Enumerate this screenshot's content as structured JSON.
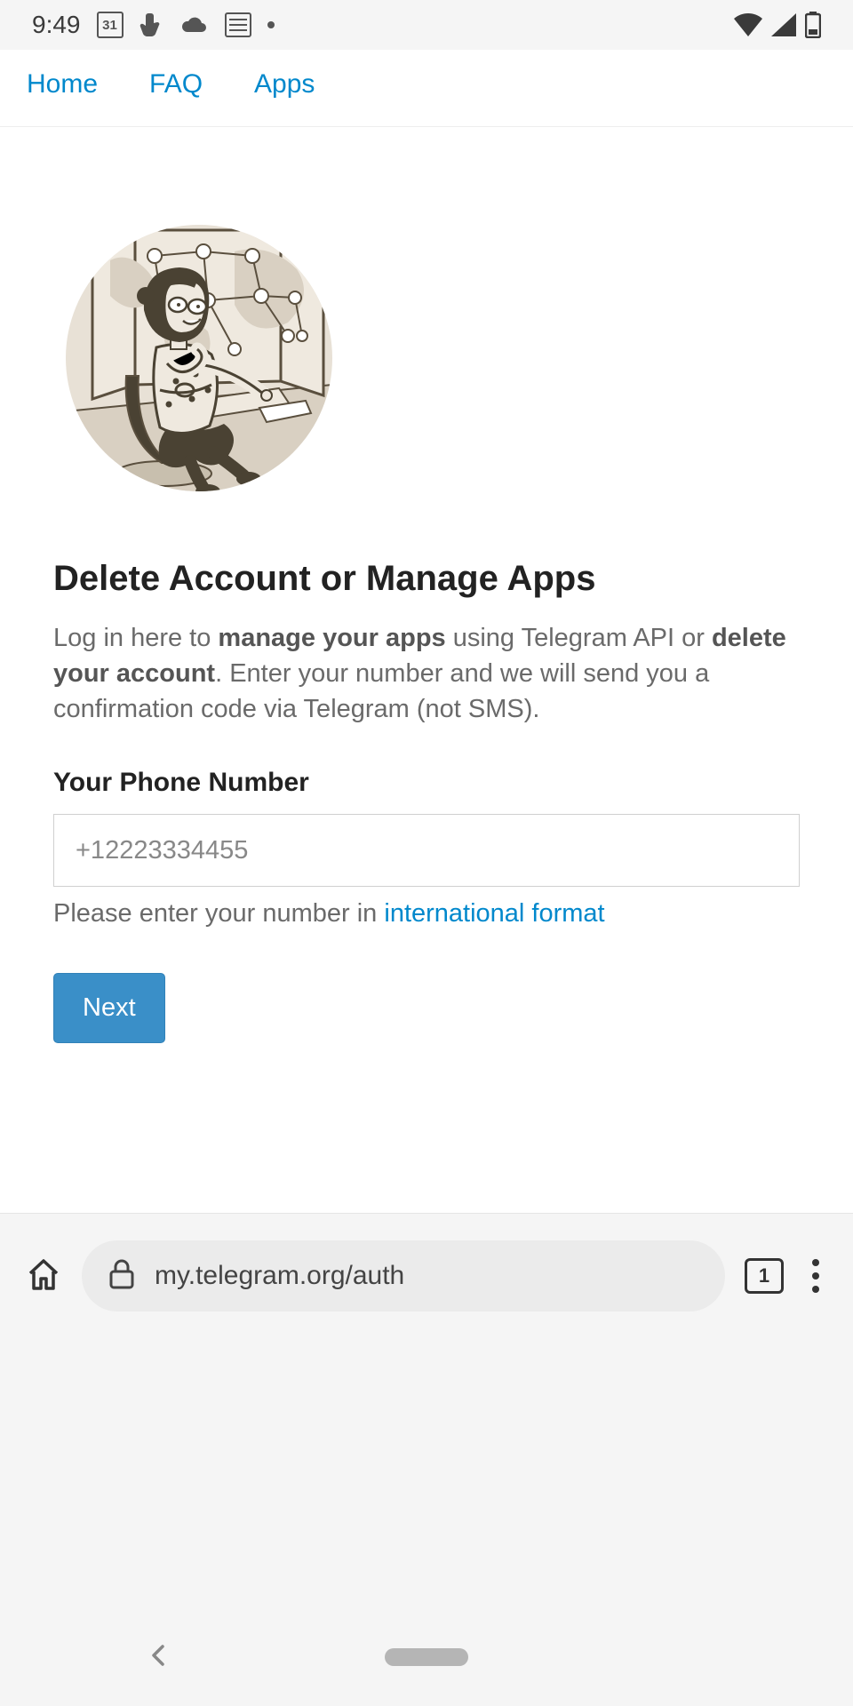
{
  "status": {
    "time": "9:49",
    "calendar_day": "31"
  },
  "nav": {
    "home": "Home",
    "faq": "FAQ",
    "apps": "Apps"
  },
  "main": {
    "title": "Delete Account or Manage Apps",
    "desc_pre": "Log in here to ",
    "desc_b1": "manage your apps",
    "desc_mid": " using Telegram API or ",
    "desc_b2": "delete your account",
    "desc_post": ". Enter your number and we will send you a confirmation code via Telegram (not SMS).",
    "phone_label": "Your Phone Number",
    "phone_placeholder": "+12223334455",
    "phone_value": "",
    "help_pre": "Please enter your number in ",
    "help_link": "international format",
    "next_label": "Next"
  },
  "browser": {
    "url": "my.telegram.org/auth",
    "tab_count": "1"
  }
}
